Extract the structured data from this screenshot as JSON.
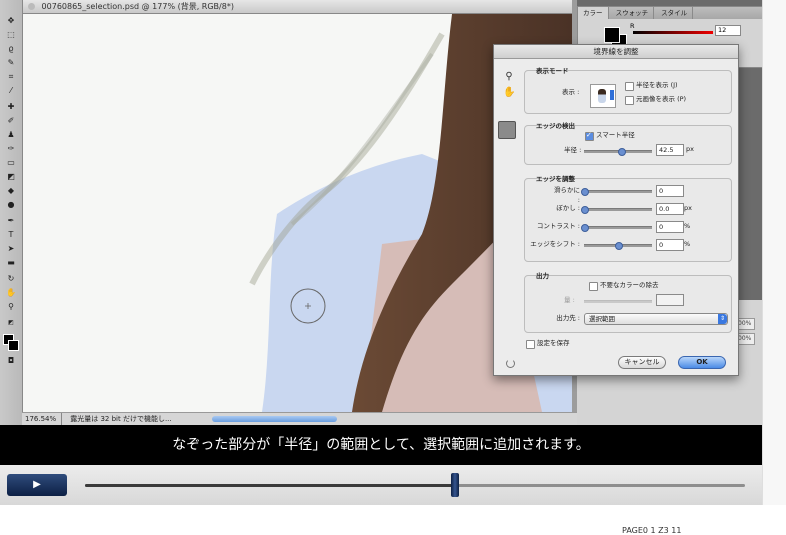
{
  "window": {
    "document_title": "00760865_selection.psd @ 177% (背景, RGB/8*)"
  },
  "toolbar": {
    "tools": [
      "move-tool",
      "marquee-tool",
      "lasso-tool",
      "quick-select-tool",
      "crop-tool",
      "eyedropper-tool",
      "healing-tool",
      "brush-tool",
      "stamp-tool",
      "history-brush-tool",
      "eraser-tool",
      "gradient-tool",
      "blur-tool",
      "dodge-tool",
      "pen-tool",
      "type-tool",
      "path-select-tool",
      "shape-tool",
      "3d-rotate-tool",
      "3d-orbit-tool",
      "hand-tool",
      "zoom-tool"
    ],
    "type_glyph": "T"
  },
  "status": {
    "zoom": "176.54%",
    "doc_info": "露光量は 32 bit だけで機能し..."
  },
  "color_panel": {
    "tabs": [
      "カラー",
      "スウォッチ",
      "スタイル"
    ],
    "r_label": "R",
    "r_value": "12"
  },
  "mini_fields": [
    "00%",
    "00%"
  ],
  "dialog": {
    "title": "境界線を調整",
    "view_mode": {
      "heading": "表示モード",
      "view_label": "表示 :",
      "show_radius": "半径を表示 (J)",
      "show_original": "元画像を表示 (P)"
    },
    "edge_detection": {
      "heading": "エッジの検出",
      "smart_radius": "スマート半径",
      "smart_radius_checked": true,
      "radius_label": "半径 :",
      "radius_value": "42.5",
      "radius_unit": "px",
      "radius_fraction": 0.17
    },
    "adjust_edge": {
      "heading": "エッジを調整",
      "rows": [
        {
          "label": "滑らかに :",
          "value": "0",
          "unit": "",
          "fraction": 0.0
        },
        {
          "label": "ぼかし :",
          "value": "0.0",
          "unit": "px",
          "fraction": 0.0
        },
        {
          "label": "コントラスト :",
          "value": "0",
          "unit": "%",
          "fraction": 0.0
        },
        {
          "label": "エッジをシフト :",
          "value": "0",
          "unit": "%",
          "fraction": 0.5
        }
      ]
    },
    "output": {
      "heading": "出力",
      "decontaminate": "不要なカラーの除去",
      "amount_label": "量 :",
      "output_to_label": "出力先 :",
      "output_to_value": "選択範囲"
    },
    "remember_settings": "設定を保存",
    "cancel": "キャンセル",
    "ok": "OK"
  },
  "subtitle": "なぞった部分が「半径」の範囲として、選択範囲に追加されます。",
  "player": {
    "play_glyph": "▶",
    "progress": 0.56
  },
  "footer_text": "PAGE0 1 Z3 11"
}
